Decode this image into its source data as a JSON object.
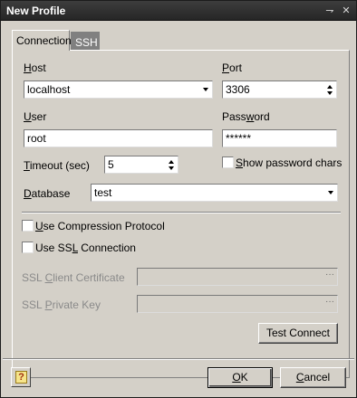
{
  "window": {
    "title": "New Profile",
    "pin_glyph": "⇁",
    "close_glyph": "✕"
  },
  "tabs": [
    {
      "label": "Connection",
      "active": true
    },
    {
      "label": "SSH",
      "active": false
    }
  ],
  "connection": {
    "host": {
      "label_ul": "H",
      "label_rest": "ost",
      "value": "localhost"
    },
    "port": {
      "label_ul": "P",
      "label_rest": "ort",
      "value": "3306"
    },
    "user": {
      "label_ul": "U",
      "label_rest": "ser",
      "value": "root"
    },
    "password": {
      "label_pre": "Pass",
      "label_ul": "w",
      "label_rest": "ord",
      "value": "******"
    },
    "timeout": {
      "label_ul": "T",
      "label_rest": "imeout (sec)",
      "value": "5"
    },
    "show_password": {
      "label_ul": "S",
      "label_rest": "how password chars",
      "checked": false
    },
    "database": {
      "label_ul": "D",
      "label_rest": "atabase",
      "value": "test"
    },
    "compression": {
      "label_ul": "U",
      "label_rest": "se Compression Protocol",
      "checked": false
    },
    "ssl": {
      "label_pre": "Use SS",
      "label_ul": "L",
      "label_rest": " Connection",
      "checked": false
    },
    "ssl_client_cert": {
      "label_pre": "SSL ",
      "label_ul": "C",
      "label_rest": "lient Certificate",
      "value": "",
      "button": "···"
    },
    "ssl_private_key": {
      "label_pre": "SSL ",
      "label_ul": "P",
      "label_rest": "rivate Key",
      "value": "",
      "button": "···"
    },
    "test_connect": "Test Connect"
  },
  "footer": {
    "help_glyph": "?",
    "ok_ul": "O",
    "ok_rest": "K",
    "cancel_ul": "C",
    "cancel_rest": "ancel"
  }
}
